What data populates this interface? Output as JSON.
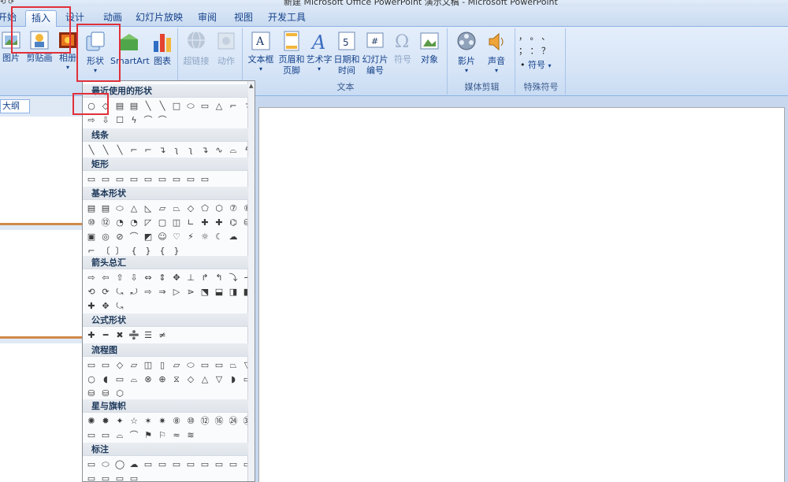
{
  "window": {
    "title": "新建 Microsoft Office PowerPoint 演示文稿 - Microsoft PowerPoint"
  },
  "tabs": [
    "开始",
    "插入",
    "设计",
    "动画",
    "幻灯片放映",
    "审阅",
    "视图",
    "开发工具"
  ],
  "active_tab": "插入",
  "ribbon": {
    "btn_picture": "图片",
    "btn_clipart": "剪贴画",
    "btn_album": "相册",
    "btn_shapes": "形状",
    "btn_smartart": "SmartArt",
    "btn_chart": "图表",
    "btn_hyperlink": "超链接",
    "btn_action": "动作",
    "btn_textbox": "文本框",
    "btn_header_1": "页眉和",
    "btn_header_2": "页脚",
    "btn_wordart": "艺术字",
    "btn_datetime_1": "日期和",
    "btn_datetime_2": "时间",
    "btn_slideno_1": "幻灯片",
    "btn_slideno_2": "编号",
    "btn_symbol": "符号",
    "btn_object": "对象",
    "group_text": "文本",
    "btn_movie": "影片",
    "btn_sound": "声音",
    "group_media": "媒体剪辑",
    "special_row1": "，  。  、",
    "special_row2": "；  ：  ？",
    "special_symbol": "符号",
    "group_special": "特殊符号"
  },
  "outline_tab": "大纲",
  "shapes_gallery": {
    "sections": [
      {
        "title": "最近使用的形状",
        "rows": [
          [
            "○",
            "◇",
            "▤",
            "▤",
            "╲",
            "╲",
            "□",
            "⬭",
            "▭",
            "△",
            "⌐",
            "↴"
          ],
          [
            "⇨",
            "⇩",
            "☐",
            "ϟ",
            "⌒",
            "⌒"
          ]
        ]
      },
      {
        "title": "线条",
        "rows": [
          [
            "╲",
            "╲",
            "╲",
            "⌐",
            "⌐",
            "↴",
            "ʅ",
            "ʅ",
            "↴",
            "∿",
            "⌓",
            "ϟ"
          ]
        ]
      },
      {
        "title": "矩形",
        "rows": [
          [
            "▭",
            "▭",
            "▭",
            "▭",
            "▭",
            "▭",
            "▭",
            "▭",
            "▭"
          ]
        ]
      },
      {
        "title": "基本形状",
        "rows": [
          [
            "▤",
            "▤",
            "⬭",
            "△",
            "◺",
            "▱",
            "⏢",
            "◇",
            "⬠",
            "⬡",
            "⑦",
            "⑧"
          ],
          [
            "⑩",
            "⑫",
            "◔",
            "◔",
            "◸",
            "▢",
            "◫",
            "∟",
            "✚",
            "✚",
            "⌬",
            "⛁"
          ],
          [
            "▣",
            "◎",
            "⊘",
            "⌒",
            "◩",
            "☺",
            "♡",
            "⚡",
            "☼",
            "☾",
            "☁"
          ],
          [
            "⌐",
            "〔",
            "〕",
            "{",
            "}",
            "{",
            "}"
          ]
        ]
      },
      {
        "title": "箭头总汇",
        "rows": [
          [
            "⇨",
            "⇦",
            "⇧",
            "⇩",
            "⇔",
            "⇕",
            "✥",
            "⊥",
            "↱",
            "↰",
            "⤵",
            "⬏"
          ],
          [
            "⟲",
            "⟳",
            "⤿",
            "⤾",
            "⇨",
            "⇒",
            "▷",
            "⋗",
            "⬔",
            "⬓",
            "◨",
            "◧"
          ],
          [
            "✚",
            "✥",
            "⤿"
          ]
        ]
      },
      {
        "title": "公式形状",
        "rows": [
          [
            "✚",
            "━",
            "✖",
            "➗",
            "☰",
            "≠"
          ]
        ]
      },
      {
        "title": "流程图",
        "rows": [
          [
            "▭",
            "▭",
            "◇",
            "▱",
            "◫",
            "▯",
            "▱",
            "⬭",
            "▭",
            "▭",
            "⏢",
            "▽"
          ],
          [
            "○",
            "◖",
            "▭",
            "⌓",
            "⊗",
            "⊕",
            "⧖",
            "◇",
            "△",
            "▽",
            "◗",
            "▭"
          ],
          [
            "⛁",
            "⛁",
            "⬡"
          ]
        ]
      },
      {
        "title": "星与旗帜",
        "rows": [
          [
            "✺",
            "✹",
            "✦",
            "☆",
            "✶",
            "✷",
            "⑧",
            "⑩",
            "⑫",
            "⑯",
            "㉔",
            "㉜"
          ],
          [
            "▭",
            "▭",
            "⌓",
            "⌒",
            "⚑",
            "⚐",
            "≈",
            "≋"
          ]
        ]
      },
      {
        "title": "标注",
        "rows": [
          [
            "▭",
            "⬭",
            "◯",
            "☁",
            "▭",
            "▭",
            "▭",
            "▭",
            "▭",
            "▭",
            "▭",
            "▭"
          ],
          [
            "▭",
            "▭",
            "▭",
            "▭"
          ]
        ]
      }
    ]
  }
}
